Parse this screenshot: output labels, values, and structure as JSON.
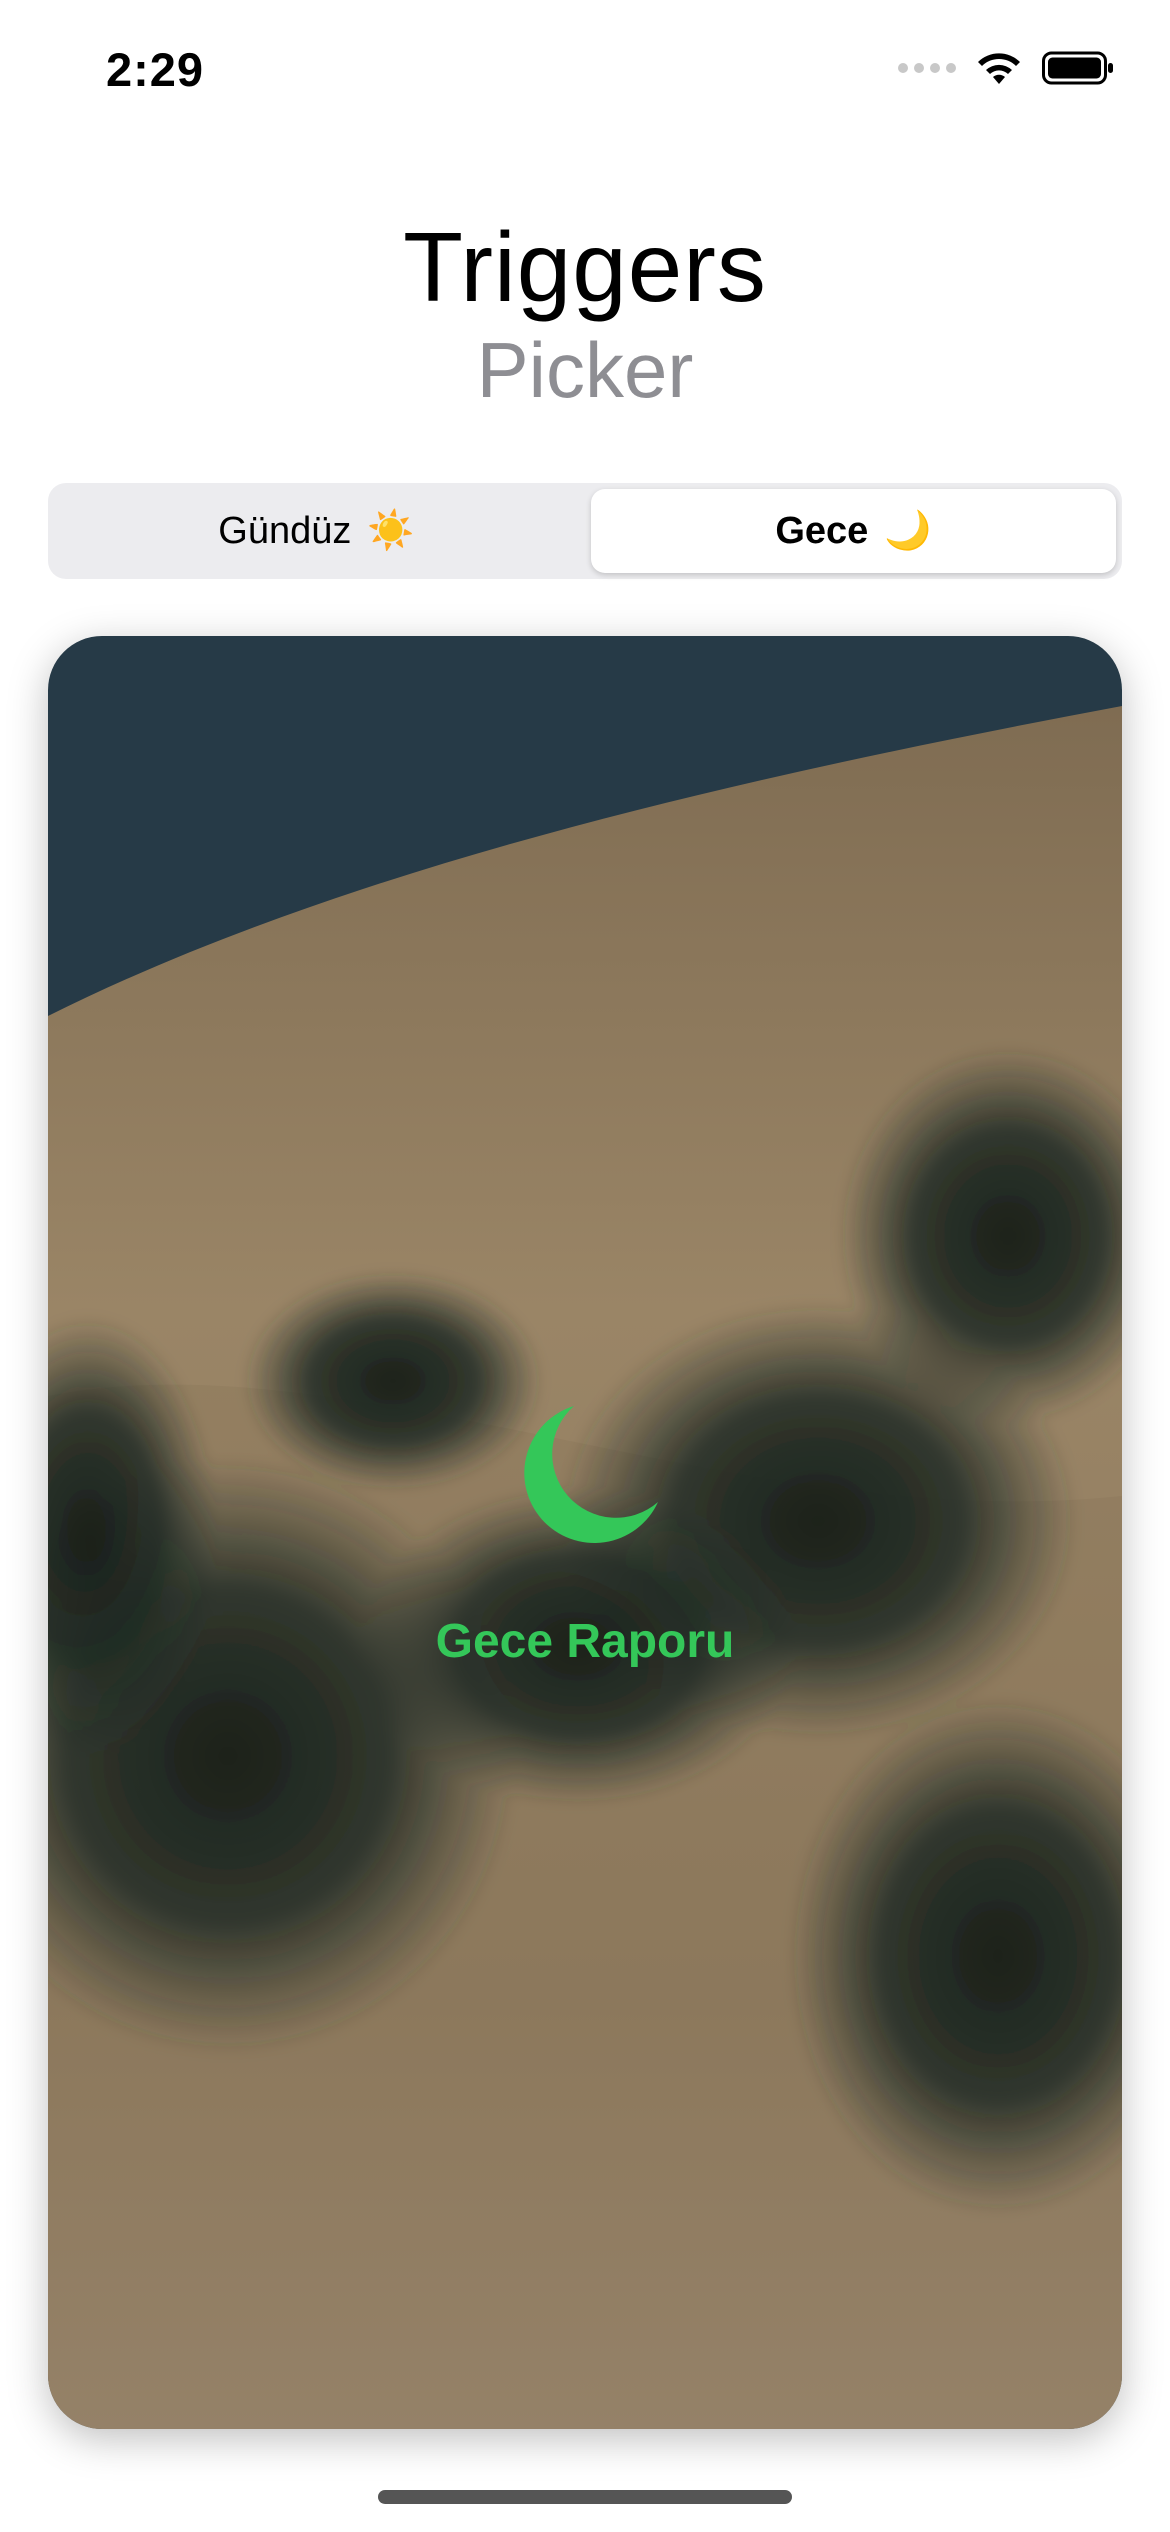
{
  "status_bar": {
    "time": "2:29"
  },
  "header": {
    "title": "Triggers",
    "subtitle": "Picker"
  },
  "picker": {
    "options": [
      {
        "label": "Gündüz",
        "emoji": "☀️"
      },
      {
        "label": "Gece",
        "emoji": "🌙"
      }
    ],
    "selected": "Gece"
  },
  "card": {
    "icon": "crescent-moon-icon",
    "label": "Gece Raporu",
    "accent_color": "#34c759",
    "sky_color": "#263a47",
    "sand_color": "#8e7a5e"
  }
}
